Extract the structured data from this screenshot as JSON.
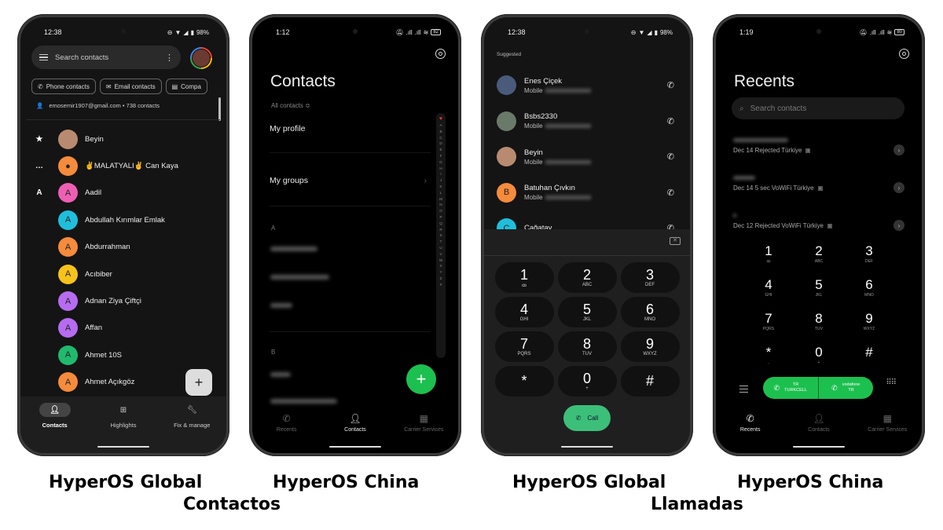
{
  "captions": {
    "p1": "HyperOS Global",
    "p2": "HyperOS China",
    "group1": "Contactos",
    "p3": "HyperOS Global",
    "p4": "HyperOS China",
    "group2": "Llamadas"
  },
  "phone1": {
    "time": "12:38",
    "battery": "98%",
    "search_placeholder": "Search contacts",
    "chips": [
      {
        "icon": "phone-icon",
        "label": "Phone contacts"
      },
      {
        "icon": "email-icon",
        "label": "Email contacts"
      },
      {
        "icon": "company-icon",
        "label": "Compa"
      }
    ],
    "account": "emosemir1907@gmail.com • 738 contacts",
    "contacts": [
      {
        "index": "★",
        "initial": "",
        "color": "#b88b70",
        "name": "Beyin",
        "photo": true
      },
      {
        "index": "…",
        "initial": "●",
        "color": "#f58b3c",
        "name": "✌MALATYALI✌ Can Kaya"
      },
      {
        "index": "A",
        "initial": "A",
        "color": "#ee5fb3",
        "name": "Aadil"
      },
      {
        "index": "",
        "initial": "A",
        "color": "#1fbfdc",
        "name": "Abdullah Kırımlar Emlak"
      },
      {
        "index": "",
        "initial": "A",
        "color": "#f58b3c",
        "name": "Abdurrahman"
      },
      {
        "index": "",
        "initial": "A",
        "color": "#f8c21c",
        "name": "Acıbiber"
      },
      {
        "index": "",
        "initial": "A",
        "color": "#b66cf0",
        "name": "Adnan Ziya Çiftçi"
      },
      {
        "index": "",
        "initial": "A",
        "color": "#b66cf0",
        "name": "Affan"
      },
      {
        "index": "",
        "initial": "A",
        "color": "#1fba6e",
        "name": "Ahmet 10S"
      },
      {
        "index": "",
        "initial": "A",
        "color": "#f58b3c",
        "name": "Ahmet Açıkgöz"
      }
    ],
    "fab": "+",
    "nav": [
      {
        "label": "Contacts",
        "icon": "person-icon",
        "active": true
      },
      {
        "label": "Highlights",
        "icon": "highlights-icon",
        "active": false
      },
      {
        "label": "Fix & manage",
        "icon": "wrench-icon",
        "active": false
      }
    ]
  },
  "phone2": {
    "time": "1:12",
    "battery": "82",
    "title": "Contacts",
    "filter": "All contacts ≎",
    "my_profile": "My profile",
    "my_groups": "My groups",
    "section_a": "A",
    "section_b": "B",
    "alphabet": [
      "A",
      "B",
      "C",
      "D",
      "E",
      "F",
      "G",
      "H",
      "I",
      "J",
      "K",
      "L",
      "M",
      "N",
      "O",
      "P",
      "Q",
      "R",
      "S",
      "T",
      "U",
      "V",
      "W",
      "X",
      "Y",
      "Z",
      "#"
    ],
    "fab": "+",
    "nav": [
      {
        "label": "Recents",
        "icon": "phone-icon",
        "active": false
      },
      {
        "label": "Contacts",
        "icon": "person-icon",
        "active": true
      },
      {
        "label": "Carrier Services",
        "icon": "store-icon",
        "active": false
      }
    ]
  },
  "phone3": {
    "time": "12:38",
    "battery": "98%",
    "suggested_label": "Suggested",
    "suggested": [
      {
        "name": "Enes Çiçek",
        "type": "Mobile",
        "initial": "",
        "color": "#4a5a7a",
        "photo": true
      },
      {
        "name": "Bsbs2330",
        "type": "Mobile",
        "initial": "",
        "color": "#6a7a6a",
        "photo": true
      },
      {
        "name": "Beyin",
        "type": "Mobile",
        "initial": "",
        "color": "#b88b70",
        "photo": true
      },
      {
        "name": "Batuhan Çıvkın",
        "type": "Mobile",
        "initial": "B",
        "color": "#f58b3c"
      },
      {
        "name": "Çağatay",
        "type": "",
        "initial": "Ç",
        "color": "#1fbfdc"
      }
    ],
    "keys": [
      {
        "d": "1",
        "l": "ꝏ"
      },
      {
        "d": "2",
        "l": "ABC"
      },
      {
        "d": "3",
        "l": "DEF"
      },
      {
        "d": "4",
        "l": "GHI"
      },
      {
        "d": "5",
        "l": "JKL"
      },
      {
        "d": "6",
        "l": "MNO"
      },
      {
        "d": "7",
        "l": "PQRS"
      },
      {
        "d": "8",
        "l": "TUV"
      },
      {
        "d": "9",
        "l": "WXYZ"
      },
      {
        "d": "*",
        "l": ""
      },
      {
        "d": "0",
        "l": "+"
      },
      {
        "d": "#",
        "l": ""
      }
    ],
    "call_label": "Call"
  },
  "phone4": {
    "time": "1:19",
    "battery": "80",
    "title": "Recents",
    "search_placeholder": "Search contacts",
    "recents": [
      {
        "meta": "Dec 14  Rejected Türkiye",
        "sim": "1"
      },
      {
        "meta": "Dec 14  5 sec VoWiFi Türkiye",
        "sim": "1"
      },
      {
        "meta": "Dec 12  Rejected VoWiFi Türkiye",
        "sim": "1"
      }
    ],
    "keys": [
      {
        "d": "1",
        "l": "ꝏ"
      },
      {
        "d": "2",
        "l": "ABC"
      },
      {
        "d": "3",
        "l": "DEF"
      },
      {
        "d": "4",
        "l": "GHI"
      },
      {
        "d": "5",
        "l": "JKL"
      },
      {
        "d": "6",
        "l": "MNO"
      },
      {
        "d": "7",
        "l": "PQRS"
      },
      {
        "d": "8",
        "l": "TUV"
      },
      {
        "d": "9",
        "l": "WXYZ"
      },
      {
        "d": "*",
        "l": ","
      },
      {
        "d": "0",
        "l": "+"
      },
      {
        "d": "#",
        "l": ""
      }
    ],
    "sim1": {
      "line1": "TR",
      "line2": "TURKCELL"
    },
    "sim2": {
      "line1": "vodafone",
      "line2": "TR"
    },
    "accent": "#1cc04f",
    "nav": [
      {
        "label": "Recents",
        "icon": "phone-icon",
        "active": true
      },
      {
        "label": "Contacts",
        "icon": "person-icon",
        "active": false
      },
      {
        "label": "Carrier Services",
        "icon": "store-icon",
        "active": false
      }
    ]
  }
}
